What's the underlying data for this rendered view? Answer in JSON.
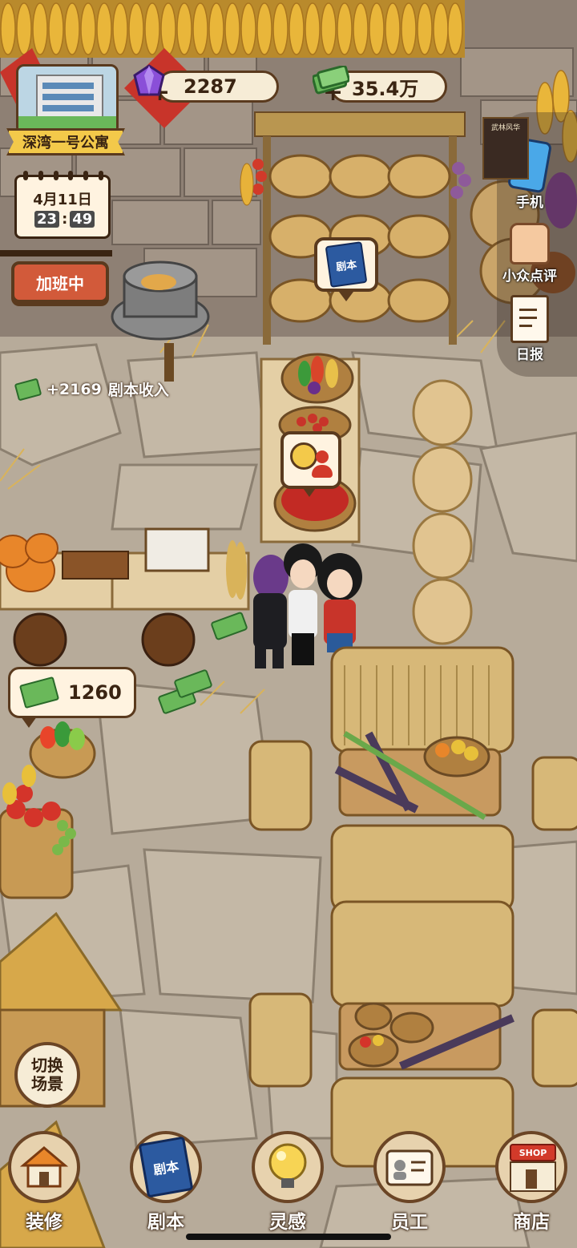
{
  "location": {
    "name": "深湾一号公寓"
  },
  "currency": {
    "gems": "2287",
    "cash": "35.4万"
  },
  "calendar": {
    "date": "4月11日",
    "hour": "23",
    "minute": "49"
  },
  "status": {
    "overtime_label": "加班中"
  },
  "income_notice": {
    "amount": "+2169",
    "label": "剧本收入"
  },
  "coin_bubble": {
    "amount": "1260"
  },
  "side_menu": {
    "phone": "手机",
    "review": "小众点评",
    "daily": "日报"
  },
  "scene_switch": {
    "line1": "切换",
    "line2": "场景"
  },
  "script_bubble": {
    "label": "剧本"
  },
  "book_cover": {
    "label": "剧本"
  },
  "shop_sign": {
    "label": "SHOP"
  },
  "poster_title": "武林风华",
  "bottom_nav": {
    "decorate": "装修",
    "script": "剧本",
    "inspiration": "灵感",
    "staff": "员工",
    "shop": "商店"
  },
  "colors": {
    "hud_border": "#5a3a1e",
    "gem_purple": "#8a4fd8",
    "cash_green": "#5aa84a",
    "red_banner": "#c8342a"
  }
}
